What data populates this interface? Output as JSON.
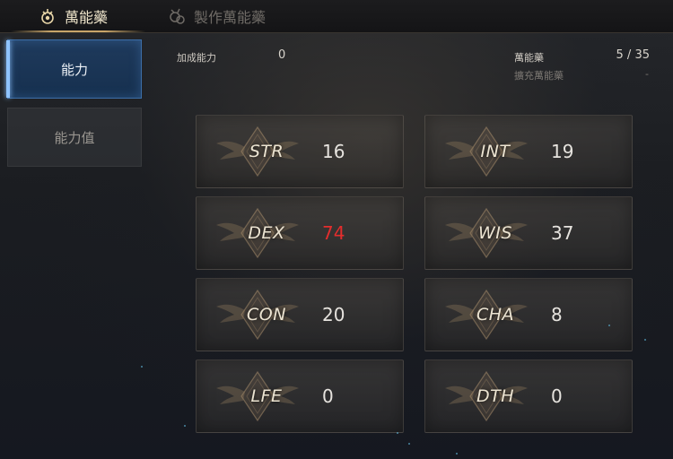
{
  "tabs": [
    {
      "label": "萬能藥",
      "icon": "elixir-icon",
      "active": true
    },
    {
      "label": "製作萬能藥",
      "icon": "craft-elixir-icon",
      "active": false
    }
  ],
  "sidebar": {
    "items": [
      {
        "label": "能力",
        "active": true
      },
      {
        "label": "能力值",
        "active": false
      }
    ]
  },
  "info": {
    "bonus_label": "加成能力",
    "bonus_value": "0",
    "elixir_label": "萬能藥",
    "elixir_value": "5 / 35",
    "extra_label": "擴充萬能藥",
    "extra_value": "-"
  },
  "stats": [
    {
      "name": "STR",
      "value": "16",
      "highlight": false
    },
    {
      "name": "INT",
      "value": "19",
      "highlight": false
    },
    {
      "name": "DEX",
      "value": "74",
      "highlight": true
    },
    {
      "name": "WIS",
      "value": "37",
      "highlight": false
    },
    {
      "name": "CON",
      "value": "20",
      "highlight": false
    },
    {
      "name": "CHA",
      "value": "8",
      "highlight": false
    },
    {
      "name": "LFE",
      "value": "0",
      "highlight": false
    },
    {
      "name": "DTH",
      "value": "0",
      "highlight": false
    }
  ],
  "colors": {
    "accent_gold": "#c9a66a",
    "active_blue": "#1f3a5c",
    "highlight_red": "#e32d2d"
  }
}
